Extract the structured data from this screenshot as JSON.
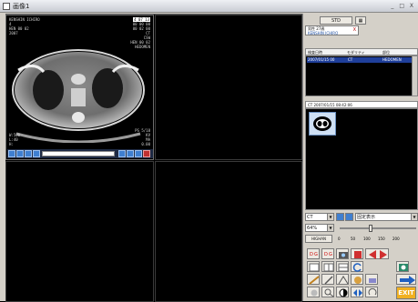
{
  "window": {
    "title": "画像1",
    "controls": "_ □ X"
  },
  "viewer": {
    "pane1": {
      "top_left": [
        "KENSHIN ICHIRO",
        "4",
        "HEN 00 02",
        "2007"
      ],
      "top_right": [
        "4 07 13",
        "00 00 00",
        "00 02 00",
        "CT",
        "CSW",
        "HEN 00 02",
        "HEDOMEN"
      ],
      "bottom_left": [
        "W:500",
        "L:40",
        "H:"
      ],
      "bottom_right": [
        "PS 5/18",
        "KV",
        "MA",
        "0.00"
      ]
    }
  },
  "side": {
    "top_button": "STD",
    "tab": {
      "label": "男性 27歳",
      "name": "KENSHIN ICHIRO",
      "close": "X"
    },
    "table": {
      "headers": [
        "検査日時",
        "モダリティ",
        "部位"
      ],
      "row": [
        "2007/01/15 00",
        "CT",
        "HEDOMEN"
      ]
    },
    "series_label": "CT 2007/01/15 08:42:06",
    "modality_select": "CT",
    "window_preset": "固定表示",
    "zoom": "64%",
    "window_label": "HIGHAN",
    "scale_ticks": [
      "0",
      "50",
      "100",
      "150",
      "200"
    ],
    "exit_label": "EXIT"
  },
  "colors": {
    "accent": "#3f7fd0",
    "selected_row": "#1f3f9a",
    "exit": "#f0b020"
  }
}
